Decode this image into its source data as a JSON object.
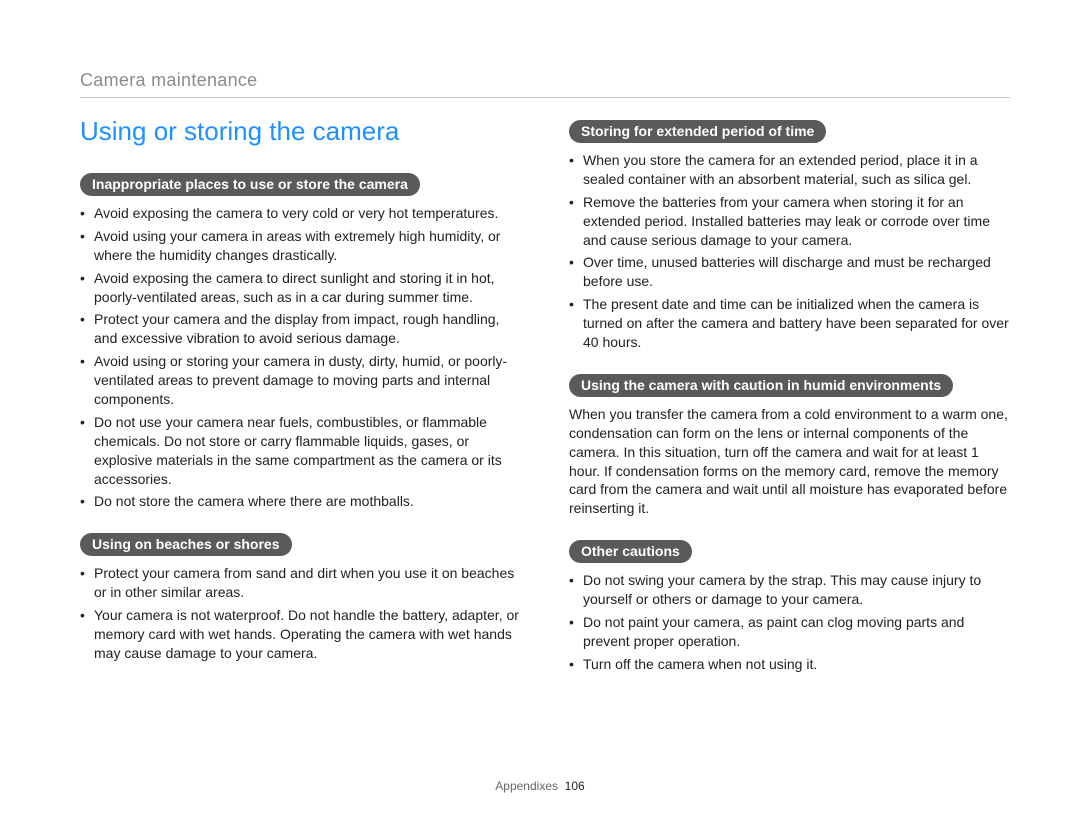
{
  "running_head": "Camera maintenance",
  "heading": "Using or storing the camera",
  "left": {
    "sec1": {
      "title": "Inappropriate places to use or store the camera",
      "items": [
        "Avoid exposing the camera to very cold or very hot temperatures.",
        "Avoid using your camera in areas with extremely high humidity, or where the humidity changes drastically.",
        "Avoid exposing the camera to direct sunlight and storing it in hot, poorly-ventilated areas, such as in a car during summer time.",
        "Protect your camera and the display from impact, rough handling, and excessive vibration to avoid serious damage.",
        "Avoid using or storing your camera in dusty, dirty, humid, or poorly-ventilated areas to prevent damage to moving parts and internal components.",
        "Do not use your camera near fuels, combustibles, or flammable chemicals. Do not store or carry flammable liquids, gases, or explosive materials in the same compartment as the camera or its accessories.",
        "Do not store the camera where there are mothballs."
      ]
    },
    "sec2": {
      "title": "Using on beaches or shores",
      "items": [
        "Protect your camera from sand and dirt when you use it on beaches or in other similar areas.",
        "Your camera is not waterproof. Do not handle the battery, adapter, or memory card with wet hands. Operating the camera with wet hands may cause damage to your camera."
      ]
    }
  },
  "right": {
    "sec1": {
      "title": "Storing for extended period of time",
      "items": [
        "When you store the camera for an extended period, place it in a sealed container with an absorbent material, such as silica gel.",
        "Remove the batteries from your camera when storing it for an extended period. Installed batteries may leak or corrode over time and cause serious damage to your camera.",
        "Over time, unused batteries will discharge and must be recharged before use.",
        "The present date and time can be initialized when the camera is turned on after the camera and battery have been separated for over 40 hours."
      ]
    },
    "sec2": {
      "title": "Using the camera with caution in humid environments",
      "para": "When you transfer the camera from a cold environment to a warm one, condensation can form on the lens or internal components of the camera. In this situation, turn off the camera and wait for at least 1 hour. If condensation forms on the memory card, remove the memory card from the camera and wait until all moisture has evaporated before reinserting it."
    },
    "sec3": {
      "title": "Other cautions",
      "items": [
        "Do not swing your camera by the strap. This may cause injury to yourself or others or damage to your camera.",
        "Do not paint your camera, as paint can clog moving parts and prevent proper operation.",
        "Turn off the camera when not using it."
      ]
    }
  },
  "footer": {
    "section": "Appendixes",
    "page": "106"
  }
}
